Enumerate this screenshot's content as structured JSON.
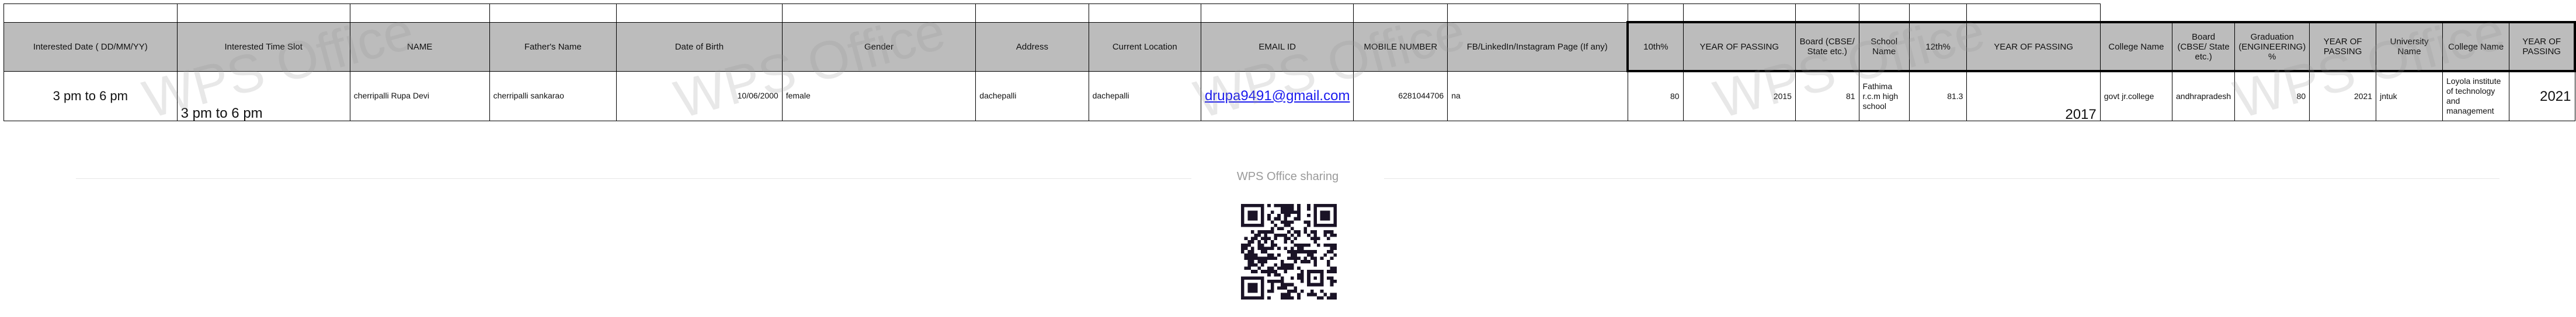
{
  "headers": [
    "Interested Date ( DD/MM/YY)",
    "Interested Time Slot",
    "NAME",
    "Father's Name",
    "Date of Birth",
    "Gender",
    "Address",
    "Current Location",
    "EMAIL ID",
    "MOBILE NUMBER",
    "FB/LinkedIn/Instagram Page (If any)",
    "10th%",
    "YEAR OF PASSING",
    "Board (CBSE/ State etc.)",
    "School Name",
    "12th%",
    "YEAR OF PASSING",
    "College Name",
    "Board (CBSE/ State etc.)",
    "Graduation (ENGINEERING) %",
    "YEAR OF PASSING",
    "University Name",
    "College Name",
    "YEAR OF PASSING"
  ],
  "row": {
    "interested_date": "3 pm to 6 pm",
    "time_slot": "3 pm to 6 pm",
    "name": "cherripalli Rupa Devi",
    "father_name": "cherripalli sankarao",
    "dob": "10/06/2000",
    "gender": "female",
    "address": "dachepalli",
    "current_location": "dachepalli",
    "email": "drupa9491@gmail.com",
    "mobile": "6281044706",
    "social": "na",
    "tenth_pct": "80",
    "tenth_year": "2015",
    "tenth_board": "81",
    "school_name": "Fathima r.c.m high school",
    "twelfth_pct": "81.3",
    "twelfth_year": "2017",
    "college_12": "govt jr.college",
    "board_grad": "andhrapradesh",
    "grad_pct": "80",
    "grad_year": "2021",
    "university": "jntuk",
    "grad_college": "Loyola institute of technology and management",
    "grad_year_2": "2021"
  },
  "watermark": "WPS Office",
  "share_label": "WPS Office sharing",
  "qr_alt": "QR code"
}
